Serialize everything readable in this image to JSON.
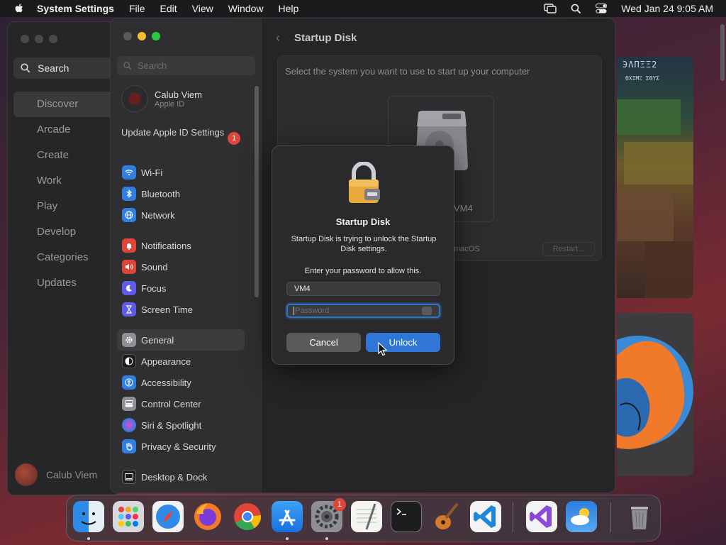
{
  "menubar": {
    "app_name": "System Settings",
    "menus": [
      "File",
      "Edit",
      "View",
      "Window",
      "Help"
    ],
    "clock": "Wed Jan 24  9:05 AM"
  },
  "appstore": {
    "search_label": "Search",
    "nav": [
      "Discover",
      "Arcade",
      "Create",
      "Work",
      "Play",
      "Develop",
      "Categories",
      "Updates"
    ],
    "selected": "Discover",
    "user_name": "Calub Viem"
  },
  "artwork": {
    "title_text": "ЭΛΠΞΞ2",
    "sub_text": "ΘΧΙΜΞ ΣΘΥΣ"
  },
  "settings": {
    "search_placeholder": "Search",
    "profile": {
      "name": "Calub Viem",
      "subtitle": "Apple ID"
    },
    "update": {
      "label": "Update Apple ID Settings",
      "badge": "1"
    },
    "group1": [
      {
        "label": "Wi-Fi",
        "icon": "wifi-icon",
        "color": "#2f7ee0"
      },
      {
        "label": "Bluetooth",
        "icon": "bluetooth-icon",
        "color": "#2f7ee0"
      },
      {
        "label": "Network",
        "icon": "globe-icon",
        "color": "#2f7ee0"
      }
    ],
    "group2": [
      {
        "label": "Notifications",
        "icon": "bell-icon",
        "color": "#e0453a"
      },
      {
        "label": "Sound",
        "icon": "speaker-icon",
        "color": "#e0453a"
      },
      {
        "label": "Focus",
        "icon": "moon-icon",
        "color": "#5e5ce6"
      },
      {
        "label": "Screen Time",
        "icon": "hourglass-icon",
        "color": "#5e5ce6"
      }
    ],
    "group3": [
      {
        "label": "General",
        "icon": "gear-icon",
        "color": "#8e8e93"
      },
      {
        "label": "Appearance",
        "icon": "appearance-icon",
        "color": "#1c1c1e"
      },
      {
        "label": "Accessibility",
        "icon": "accessibility-icon",
        "color": "#2f7ee0"
      },
      {
        "label": "Control Center",
        "icon": "control-center-icon",
        "color": "#8e8e93"
      },
      {
        "label": "Siri & Spotlight",
        "icon": "siri-icon",
        "color": "#b04ad8"
      },
      {
        "label": "Privacy & Security",
        "icon": "hand-icon",
        "color": "#2f7ee0"
      }
    ],
    "group4": [
      {
        "label": "Desktop & Dock",
        "icon": "dock-icon",
        "color": "#1c1c1e"
      }
    ],
    "selected": "General",
    "content": {
      "title": "Startup Disk",
      "instruction": "Select the system you want to use to start up your computer",
      "disk_label": "VM4",
      "os_label": "macOS",
      "restart_label": "Restart..."
    }
  },
  "dialog": {
    "title": "Startup Disk",
    "message": "Startup Disk is trying to unlock the Startup Disk settings.",
    "prompt": "Enter your password to allow this.",
    "username": "VM4",
    "password_placeholder": "Password",
    "cancel_label": "Cancel",
    "unlock_label": "Unlock"
  },
  "dock": {
    "apps": [
      "Finder",
      "Launchpad",
      "Safari",
      "Firefox",
      "Chrome",
      "App Store",
      "System Settings",
      "TextEdit",
      "Terminal",
      "GarageBand",
      "Visual Studio Code",
      "Visual Studio",
      "Weather",
      "Trash"
    ],
    "settings_badge": "1"
  }
}
